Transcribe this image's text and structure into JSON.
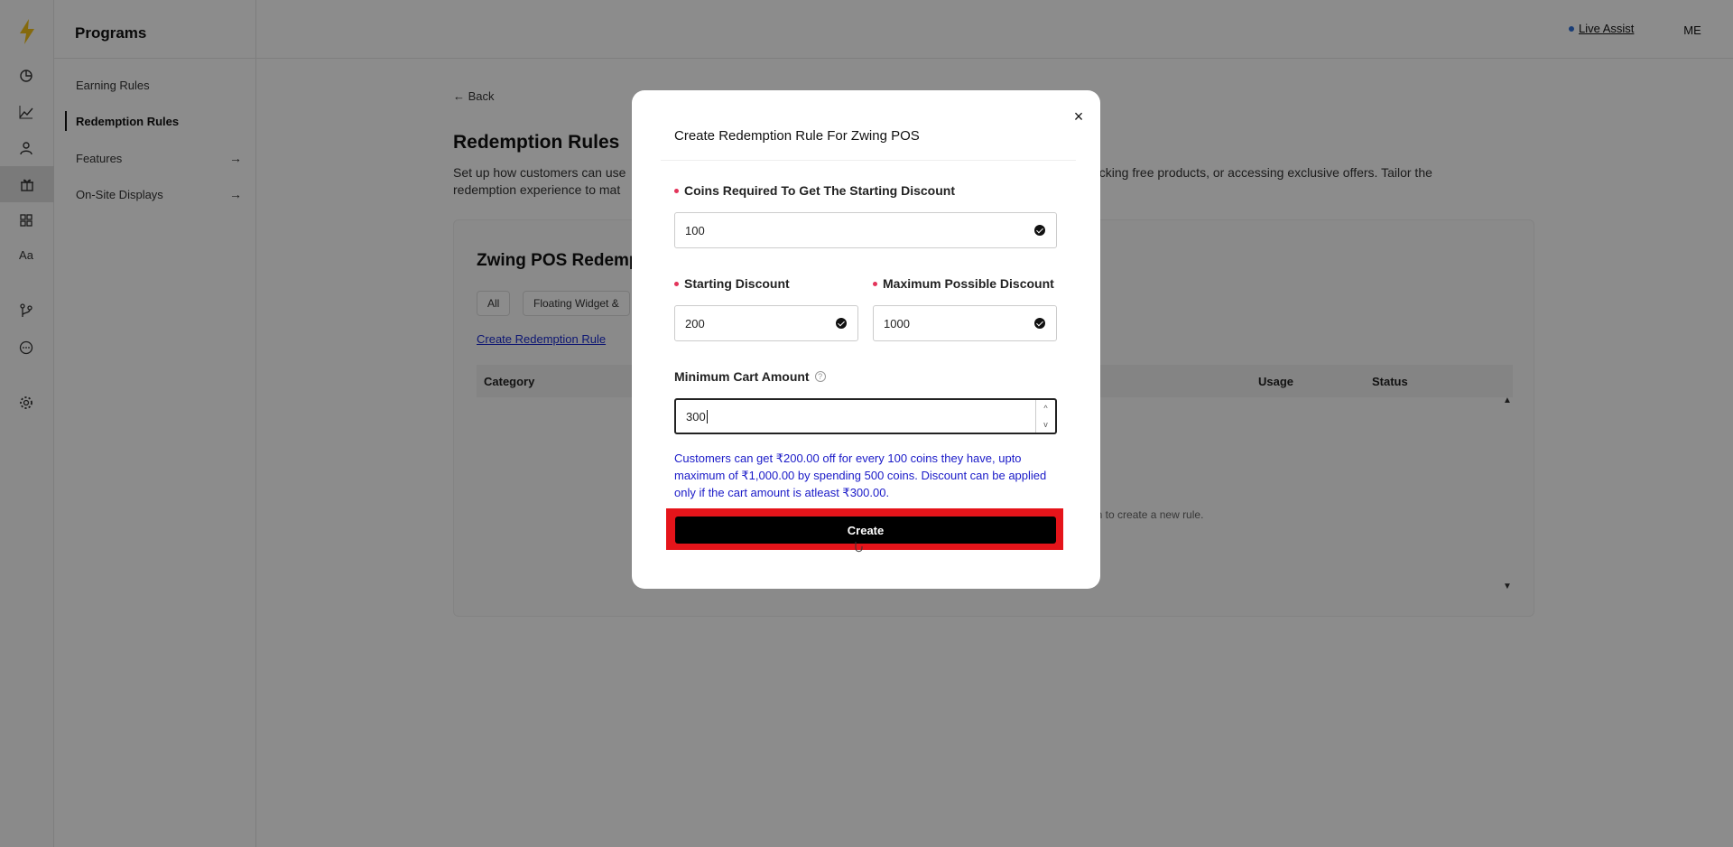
{
  "rail": {
    "icons": [
      "lightning-logo",
      "dashboard-icon",
      "analytics-icon",
      "customers-icon",
      "programs-gift-icon",
      "widgets-icon",
      "typography-icon",
      "integrations-icon",
      "chat-icon",
      "settings-icon"
    ]
  },
  "sidebar": {
    "title": "Programs",
    "items": [
      {
        "label": "Earning Rules"
      },
      {
        "label": "Redemption Rules"
      },
      {
        "label": "Features"
      },
      {
        "label": "On-Site Displays"
      }
    ]
  },
  "header": {
    "live_assist": "Live Assist",
    "avatar": "ME"
  },
  "main": {
    "back": "Back",
    "title": "Redemption Rules",
    "description_left": "Set up how customers can use",
    "description_right": "ocking free products, or accessing exclusive offers. Tailor the",
    "description_line2": "redemption experience to mat",
    "card_title": "Zwing POS Redemp",
    "chips": [
      "All",
      "Floating Widget &"
    ],
    "create_link": "Create Redemption Rule",
    "table_headers": [
      "Category",
      "Usage",
      "Status"
    ],
    "empty_text": "on to create a new rule."
  },
  "modal": {
    "title": "Create Redemption Rule For Zwing POS",
    "close": "×",
    "fields": {
      "coins_label": "Coins Required To Get The Starting Discount",
      "coins_value": "100",
      "starting_label": "Starting Discount",
      "starting_value": "200",
      "max_label": "Maximum Possible Discount",
      "max_value": "1000",
      "min_cart_label": "Minimum Cart Amount",
      "min_cart_value": "300"
    },
    "info_text": "Customers can get ₹200.00 off for every 100 coins they have, upto maximum of ₹1,000.00 by spending 500 coins. Discount can be applied only if the cart amount is atleast ₹300.00.",
    "create_button": "Create"
  },
  "colors": {
    "accent_link": "#1a2bd1",
    "required_dot": "#e3345a",
    "highlight": "#e5141a",
    "info_text": "#1a1ac8",
    "logo": "#f2c21b"
  }
}
